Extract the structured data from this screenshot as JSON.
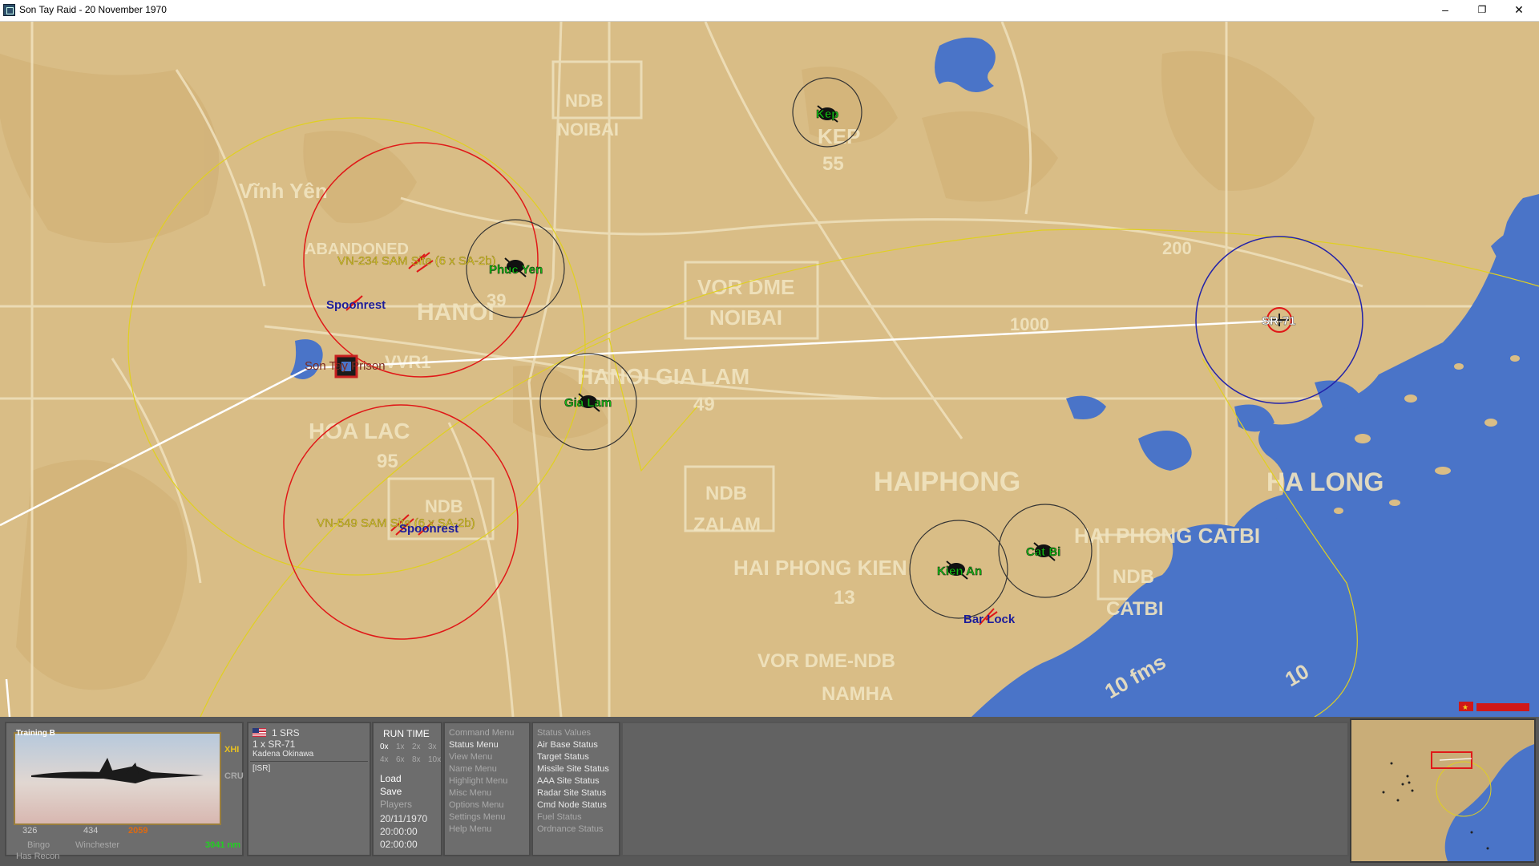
{
  "window": {
    "title": "Son Tay Raid - 20 November 1970"
  },
  "map": {
    "places": {
      "kep": "Kep",
      "phuc_yen": "Phuc Yen",
      "gia_lam": "Gia Lam",
      "kien_an": "Kien An",
      "cat_bi": "Cat Bi",
      "son_tay_prison": "Son Tay Prison",
      "sr71": "SR-71",
      "sam_234": "VN-234 SAM Site (6 x SA-2b)",
      "sam_549": "VN-549 SAM Site (6 x SA-2b)",
      "spoonrest_1": "Spoonrest",
      "spoonrest_2": "Spoonrest",
      "bar_lock": "Bar Lock"
    },
    "base_labels": [
      {
        "text": "Vĩnh Yên"
      },
      {
        "text": "ABANDONED"
      },
      {
        "text": "NDB"
      },
      {
        "text": "NOIBAI"
      },
      {
        "text": "KEP"
      },
      {
        "text": "55"
      },
      {
        "text": "VOR DME"
      },
      {
        "text": "NOIBAI"
      },
      {
        "text": "HANOI"
      },
      {
        "text": "VVR1"
      },
      {
        "text": "HANOI GIA LAM"
      },
      {
        "text": "49"
      },
      {
        "text": "HOA LAC"
      },
      {
        "text": "95"
      },
      {
        "text": "NDB"
      },
      {
        "text": "NDB"
      },
      {
        "text": "ZALAM"
      },
      {
        "text": "HAIPHONG"
      },
      {
        "text": "HAI PHONG KIEN"
      },
      {
        "text": "13"
      },
      {
        "text": "HAI PHONG CATBI"
      },
      {
        "text": "NDB"
      },
      {
        "text": "CATBI"
      },
      {
        "text": "HA LONG"
      },
      {
        "text": "VOR DME-NDB"
      },
      {
        "text": "NAMHA"
      },
      {
        "text": "10 fms"
      },
      {
        "text": "10"
      },
      {
        "text": "1000"
      },
      {
        "text": "200"
      },
      {
        "text": "39"
      }
    ],
    "colors": {
      "land": "#d9bd86",
      "water": "#4a74c8",
      "sam_ring": "#e01818",
      "airbase_ring": "#333333",
      "selection_ring": "#2222aa",
      "coverage": "#e0d020",
      "route": "#ffffff"
    }
  },
  "unit": {
    "photo_label": "Training B",
    "flag": "us-flag-icon",
    "squadron": "1 SRS",
    "aircraft": "1 x SR-71",
    "base": "Kadena Okinawa",
    "mission": "[ISR]",
    "alt_codes": [
      "XHI",
      "CRU"
    ],
    "stats": [
      "326",
      "434",
      "2059"
    ],
    "bingo": "Bingo",
    "winchester": "Winchester",
    "range": "3041 nm",
    "recon": "Has Recon"
  },
  "runtime": {
    "title": "RUN TIME",
    "speeds_row1": [
      "0x",
      "1x",
      "2x",
      "3x"
    ],
    "speeds_row2": [
      "4x",
      "6x",
      "8x",
      "10x"
    ],
    "load": "Load",
    "save": "Save",
    "players": "Players",
    "date": "20/11/1970",
    "time1": "20:00:00",
    "time2": "02:00:00"
  },
  "menus": [
    "Command Menu",
    "Status Menu",
    "View Menu",
    "Name Menu",
    "Highlight Menu",
    "Misc Menu",
    "Options Menu",
    "Settings Menu",
    "Help Menu"
  ],
  "status": [
    "Status Values",
    "Air Base Status",
    "Target Status",
    "Missile Site Status",
    "AAA Site Status",
    "Radar Site Status",
    "Cmd Node Status",
    "Fuel Status",
    "Ordnance Status"
  ]
}
